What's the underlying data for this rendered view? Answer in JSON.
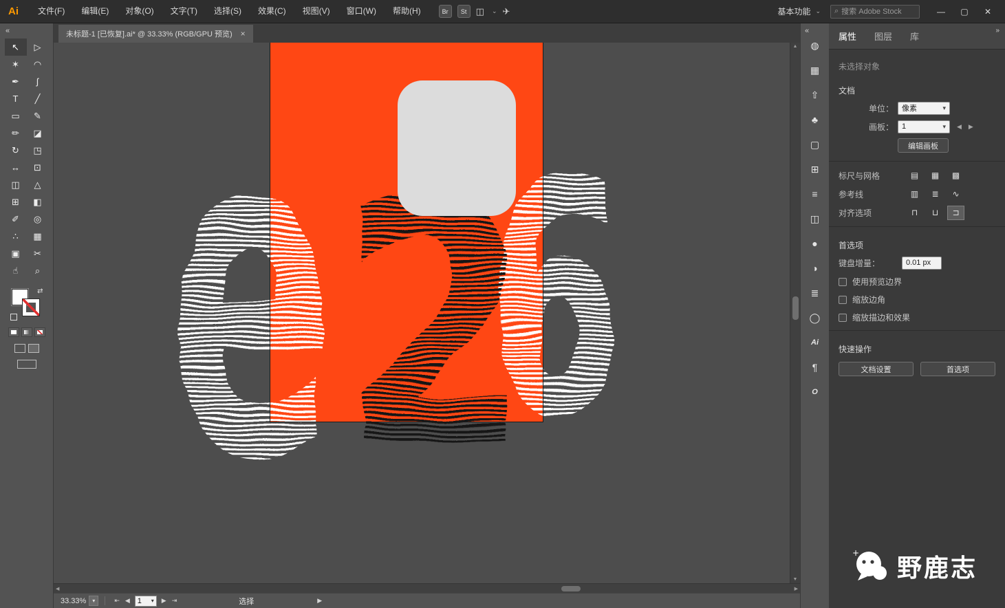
{
  "colors": {
    "artboard_orange": "#FF4714",
    "stripe_white": "#FFFFFF",
    "stripe_black": "#121212",
    "rounded_rect_gray": "#DCDCDC"
  },
  "menubar": {
    "logo": "Ai",
    "items": [
      "文件(F)",
      "编辑(E)",
      "对象(O)",
      "文字(T)",
      "选择(S)",
      "效果(C)",
      "视图(V)",
      "窗口(W)",
      "帮助(H)"
    ],
    "badge_br": "Br",
    "badge_st": "St",
    "workspace": "基本功能",
    "search_placeholder": "搜索 Adobe Stock"
  },
  "icons": {
    "search": "⌕",
    "caret": "⌄",
    "layout": "◫",
    "send": "✈",
    "minimize": "—",
    "maximize": "▢",
    "close": "✕",
    "collapse_left": "«",
    "collapse_right": "»",
    "up": "▲",
    "down": "▼",
    "left": "◀",
    "right": "▶",
    "first": "⇤",
    "last": "⇥",
    "tab_close": "×",
    "swap": "⇄",
    "field_caret": "▾"
  },
  "tabbar": {
    "title": "未标题-1 [已恢复].ai* @ 33.33% (RGB/GPU 预览)"
  },
  "toolbar": {
    "tools": [
      {
        "name": "selection-tool",
        "glyph": "↖",
        "active": true
      },
      {
        "name": "direct-selection-tool",
        "glyph": "▷"
      },
      {
        "name": "magic-wand-tool",
        "glyph": "✶"
      },
      {
        "name": "lasso-tool",
        "glyph": "◠"
      },
      {
        "name": "pen-tool",
        "glyph": "✒"
      },
      {
        "name": "curvature-tool",
        "glyph": "ʃ"
      },
      {
        "name": "type-tool",
        "glyph": "T"
      },
      {
        "name": "line-segment-tool",
        "glyph": "╱"
      },
      {
        "name": "rectangle-tool",
        "glyph": "▭"
      },
      {
        "name": "paintbrush-tool",
        "glyph": "✎"
      },
      {
        "name": "shaper-tool",
        "glyph": "✏"
      },
      {
        "name": "eraser-tool",
        "glyph": "◪"
      },
      {
        "name": "rotate-tool",
        "glyph": "↻"
      },
      {
        "name": "scale-tool",
        "glyph": "◳"
      },
      {
        "name": "width-tool",
        "glyph": "↔"
      },
      {
        "name": "free-transform-tool",
        "glyph": "⊡"
      },
      {
        "name": "shape-builder-tool",
        "glyph": "◫"
      },
      {
        "name": "perspective-grid-tool",
        "glyph": "△"
      },
      {
        "name": "mesh-tool",
        "glyph": "⊞"
      },
      {
        "name": "gradient-tool",
        "glyph": "◧"
      },
      {
        "name": "eyedropper-tool",
        "glyph": "✐"
      },
      {
        "name": "blend-tool",
        "glyph": "◎"
      },
      {
        "name": "symbol-sprayer-tool",
        "glyph": "∴"
      },
      {
        "name": "column-graph-tool",
        "glyph": "▦"
      },
      {
        "name": "artboard-tool",
        "glyph": "▣"
      },
      {
        "name": "slice-tool",
        "glyph": "✂"
      },
      {
        "name": "hand-tool",
        "glyph": "☝"
      },
      {
        "name": "zoom-tool",
        "glyph": "⌕"
      }
    ]
  },
  "artwork": {
    "letters": [
      "e",
      "2",
      "6"
    ]
  },
  "panel_strip": {
    "icons": [
      {
        "name": "color-panel-icon",
        "glyph": "◍"
      },
      {
        "name": "artboards-panel-icon",
        "glyph": "▦"
      },
      {
        "name": "asset-export-panel-icon",
        "glyph": "⇧"
      },
      {
        "name": "brushes-panel-icon",
        "glyph": "♣"
      },
      {
        "name": "swatches-panel-icon",
        "glyph": "▢"
      },
      {
        "name": "transform-panel-icon",
        "glyph": "⊞"
      },
      {
        "name": "align-panel-icon",
        "glyph": "≡"
      },
      {
        "name": "pathfinder-panel-icon",
        "glyph": "◫"
      },
      {
        "name": "appearance-panel-icon",
        "glyph": "●"
      },
      {
        "name": "gradient-panel-icon",
        "glyph": "◑"
      },
      {
        "name": "stroke-panel-icon",
        "glyph": "≣"
      },
      {
        "name": "transparency-panel-icon",
        "glyph": "◯"
      },
      {
        "name": "character-panel-icon",
        "glyph": "Ai"
      },
      {
        "name": "paragraph-panel-icon",
        "glyph": "¶"
      },
      {
        "name": "opentype-panel-icon",
        "glyph": "O"
      }
    ]
  },
  "properties": {
    "tabs": [
      "属性",
      "图层",
      "库"
    ],
    "no_selection": "未选择对象",
    "document": {
      "title": "文档",
      "unit_label": "单位：",
      "unit_value": "像素",
      "artboard_label": "画板：",
      "artboard_value": "1",
      "edit_artboard": "编辑画板",
      "rulers_label": "标尺与网格",
      "rulers_icons": [
        "▤",
        "▦",
        "▩"
      ],
      "guides_label": "参考线",
      "guides_icons": [
        "▥",
        "≣",
        "∿"
      ],
      "snap_label": "对齐选项",
      "snap_icons": [
        "⊓",
        "⊔",
        "⊐"
      ]
    },
    "preferences": {
      "title": "首选项",
      "increment_label": "键盘增量：",
      "increment_value": "0.01 px",
      "checkbox_1": "使用预览边界",
      "checkbox_2": "缩放边角",
      "checkbox_3": "缩放描边和效果"
    },
    "quick": {
      "title": "快速操作",
      "button_1": "文档设置",
      "button_2": "首选项"
    }
  },
  "statusbar": {
    "zoom": "33.33%",
    "artboard": "1",
    "status": "选择"
  },
  "watermark": {
    "text": "野鹿志"
  }
}
